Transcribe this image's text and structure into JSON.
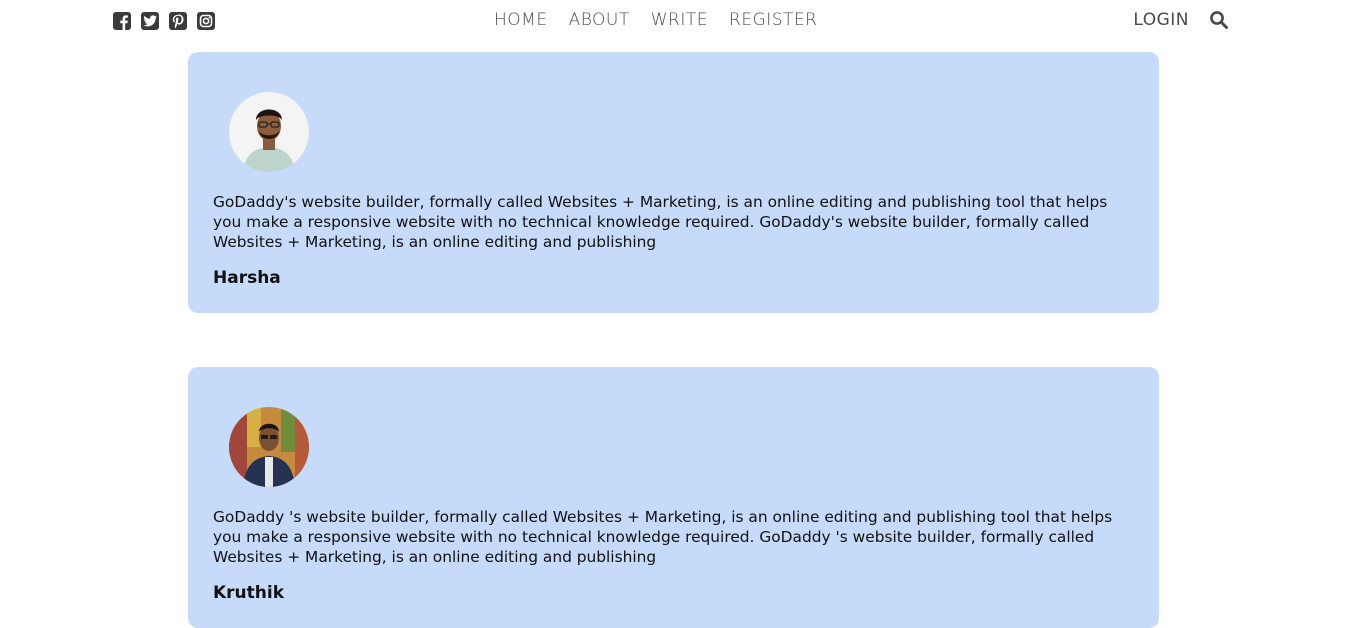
{
  "social": [
    {
      "icon": "facebook-icon"
    },
    {
      "icon": "twitter-icon"
    },
    {
      "icon": "pinterest-icon"
    },
    {
      "icon": "instagram-icon"
    }
  ],
  "nav": {
    "items": [
      "HOME",
      "ABOUT",
      "WRITE",
      "REGISTER"
    ],
    "login": "LOGIN",
    "search_icon": "search-icon"
  },
  "colors": {
    "card_bg": "#c6dbf9",
    "nav_text": "#4a4a4a"
  },
  "posts": [
    {
      "text": "GoDaddy's website builder, formally called Websites + Marketing, is an online editing and publishing tool that helps you make a responsive website with no technical knowledge required. GoDaddy's website builder, formally called Websites + Marketing, is an online editing and publishing",
      "author": "Harsha"
    },
    {
      "text": "GoDaddy 's website builder, formally called Websites + Marketing, is an online editing and publishing tool that helps you make a responsive website with no technical knowledge required. GoDaddy 's website builder, formally called Websites + Marketing, is an online editing and publishing",
      "author": "Kruthik"
    }
  ]
}
